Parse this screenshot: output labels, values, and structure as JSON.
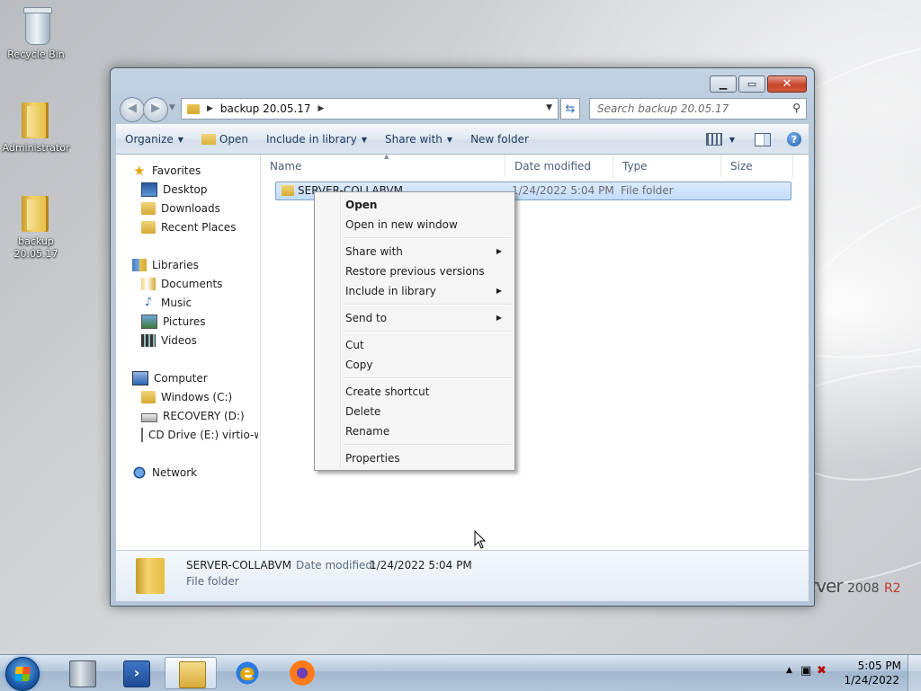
{
  "desktop": {
    "icons": [
      {
        "label": "Recycle Bin"
      },
      {
        "label": "Administrator"
      },
      {
        "label": "backup 20.05.17"
      }
    ],
    "brand": {
      "text": "rver",
      "year": "2008",
      "suffix": "R2"
    }
  },
  "window": {
    "address": {
      "crumb": "backup 20.05.17"
    },
    "search": {
      "placeholder": "Search backup 20.05.17"
    },
    "toolbar": {
      "organize": "Organize",
      "open": "Open",
      "include_in_library": "Include in library",
      "share_with": "Share with",
      "new_folder": "New folder"
    },
    "sidebar": {
      "favorites": "Favorites",
      "desktop": "Desktop",
      "downloads": "Downloads",
      "recent_places": "Recent Places",
      "libraries": "Libraries",
      "documents": "Documents",
      "music": "Music",
      "pictures": "Pictures",
      "videos": "Videos",
      "computer": "Computer",
      "windows_c": "Windows (C:)",
      "recovery_d": "RECOVERY (D:)",
      "cd_drive": "CD Drive (E:) virtio-w",
      "network": "Network"
    },
    "columns": {
      "name": "Name",
      "date_modified": "Date modified",
      "type": "Type",
      "size": "Size"
    },
    "file": {
      "name": "SERVER-COLLABVM",
      "date": "1/24/2022 5:04 PM",
      "type": "File folder"
    },
    "details": {
      "name": "SERVER-COLLABVM",
      "date_label": "Date modified:",
      "date_value": "1/24/2022 5:04 PM",
      "type": "File folder"
    }
  },
  "context_menu": {
    "open": "Open",
    "open_new_window": "Open in new window",
    "share_with": "Share with",
    "restore_previous": "Restore previous versions",
    "include_in_library": "Include in library",
    "send_to": "Send to",
    "cut": "Cut",
    "copy": "Copy",
    "create_shortcut": "Create shortcut",
    "delete": "Delete",
    "rename": "Rename",
    "properties": "Properties"
  },
  "taskbar": {
    "time": "5:05 PM",
    "date": "1/24/2022"
  }
}
